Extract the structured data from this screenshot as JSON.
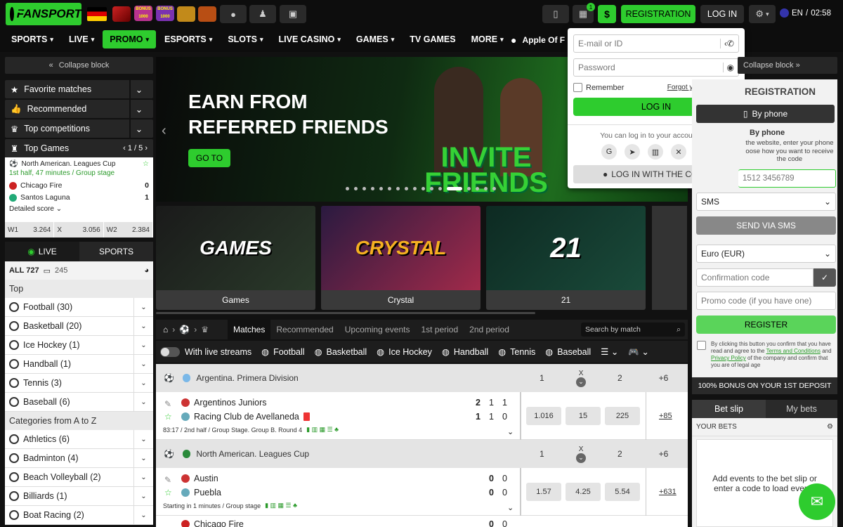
{
  "topbar": {
    "logo_text": "FANSPORT",
    "registration_label": "REGISTRATION",
    "login_label": "LOG IN",
    "language": "EN",
    "time": "02:58",
    "gift_badge": "1",
    "promo_icon_1": "BONUS 1000",
    "promo_icon_2": "BONUS 1000"
  },
  "menu": {
    "items": [
      "SPORTS",
      "LIVE",
      "PROMO",
      "ESPORTS",
      "SLOTS",
      "LIVE CASINO",
      "GAMES",
      "TV GAMES",
      "MORE"
    ],
    "apple_label": "Apple Of F"
  },
  "left": {
    "collapse_label": "Collapse block",
    "favorite": "Favorite matches",
    "recommended": "Recommended",
    "top_competitions": "Top competitions",
    "top_games": "Top Games",
    "top_games_pager": "1 / 5",
    "match": {
      "league": "North American. Leagues Cup",
      "status": "1st half, 47 minutes / Group stage",
      "team1": "Chicago Fire",
      "score1": "0",
      "team2": "Santos Laguna",
      "score2": "1",
      "detailed": "Detailed score",
      "odds": [
        {
          "label": "W1",
          "value": "3.264"
        },
        {
          "label": "X",
          "value": "3.056"
        },
        {
          "label": "W2",
          "value": "2.384"
        }
      ]
    },
    "tab_live": "LIVE",
    "tab_sports": "SPORTS",
    "all_label": "ALL 727",
    "all_count": "245",
    "top_label": "Top",
    "sports": [
      "Football (30)",
      "Basketball (20)",
      "Ice Hockey (1)",
      "Handball (1)",
      "Tennis (3)",
      "Baseball (6)"
    ],
    "categories_label": "Categories from A to Z",
    "categories": [
      "Athletics (6)",
      "Badminton (4)",
      "Beach Volleyball (2)",
      "Billiards (1)",
      "Boat Racing (2)"
    ]
  },
  "banner": {
    "headline": "EARN FROM REFERRED FRIENDS",
    "button": "GO TO",
    "sign": "INVITE FRIENDS"
  },
  "games": [
    {
      "label": "Games",
      "art": "GAMES"
    },
    {
      "label": "Crystal",
      "art": "CRYSTAL"
    },
    {
      "label": "21",
      "art": "21"
    }
  ],
  "center": {
    "tabs": [
      "Matches",
      "Recommended",
      "Upcoming events",
      "1st period",
      "2nd period"
    ],
    "search_placeholder": "Search by match",
    "streams_label": "With live streams",
    "sport_filters": [
      "Football",
      "Basketball",
      "Ice Hockey",
      "Handball",
      "Tennis",
      "Baseball"
    ],
    "leagues": [
      {
        "name": "Argentina. Primera Division",
        "h1": "1",
        "hx": "X",
        "h2": "2",
        "more": "+6",
        "team1": "Argentinos Juniors",
        "team2": "Racing Club de Avellaneda",
        "s1": [
          "2",
          "1",
          "1"
        ],
        "s2": [
          "1",
          "1",
          "0"
        ],
        "info": "83:17 / 2nd half / Group Stage. Group B. Round 4",
        "odds": [
          "1.016",
          "15",
          "225"
        ],
        "plus": "+85"
      },
      {
        "name": "North American. Leagues Cup",
        "h1": "1",
        "hx": "X",
        "h2": "2",
        "more": "+6",
        "team1": "Austin",
        "team2": "Puebla",
        "s1": [
          "0",
          "0"
        ],
        "s2": [
          "0",
          "0"
        ],
        "info": "Starting in 1 minutes / Group stage",
        "odds": [
          "1.57",
          "4.25",
          "5.54"
        ],
        "plus": "+631"
      }
    ],
    "next_team": "Chicago Fire",
    "next_s": [
      "0",
      "0"
    ]
  },
  "login": {
    "email_placeholder": "E-mail or ID",
    "password_placeholder": "Password",
    "remember": "Remember",
    "forgot": "Forgot your password?",
    "login_btn": "LOG IN",
    "via_text": "You can log in to your account via:",
    "code_btn": "LOG IN WITH THE CODE"
  },
  "right": {
    "collapse_label": "Collapse block",
    "reg_title": "REGISTRATION",
    "by_phone_btn": "By phone",
    "by_phone_title": "By phone",
    "by_phone_desc": "the website, enter your phone oose how you want to receive the code",
    "phone_placeholder": "1512 3456789",
    "sms_select": "SMS",
    "send_sms": "SEND VIA SMS",
    "currency": "Euro (EUR)",
    "confirm_placeholder": "Confirmation code",
    "promo_placeholder": "Promo code (if you have one)",
    "register": "REGISTER",
    "terms_1": "By clicking this button you confirm that you have read and agree to the",
    "terms_link1": "Terms and Conditions",
    "terms_and": "and",
    "terms_link2": "Privacy Policy",
    "terms_2": "of the company and confirm that you are of legal age",
    "bonus": "100% BONUS ON YOUR 1ST DEPOSIT",
    "tab_betslip": "Bet slip",
    "tab_mybets": "My bets",
    "your_bets": "YOUR BETS",
    "empty_text": "Add events to the bet slip or enter a code to load events"
  },
  "colors": {
    "accent": "#2ecc2e",
    "dark": "#111111",
    "panel": "#262626"
  }
}
